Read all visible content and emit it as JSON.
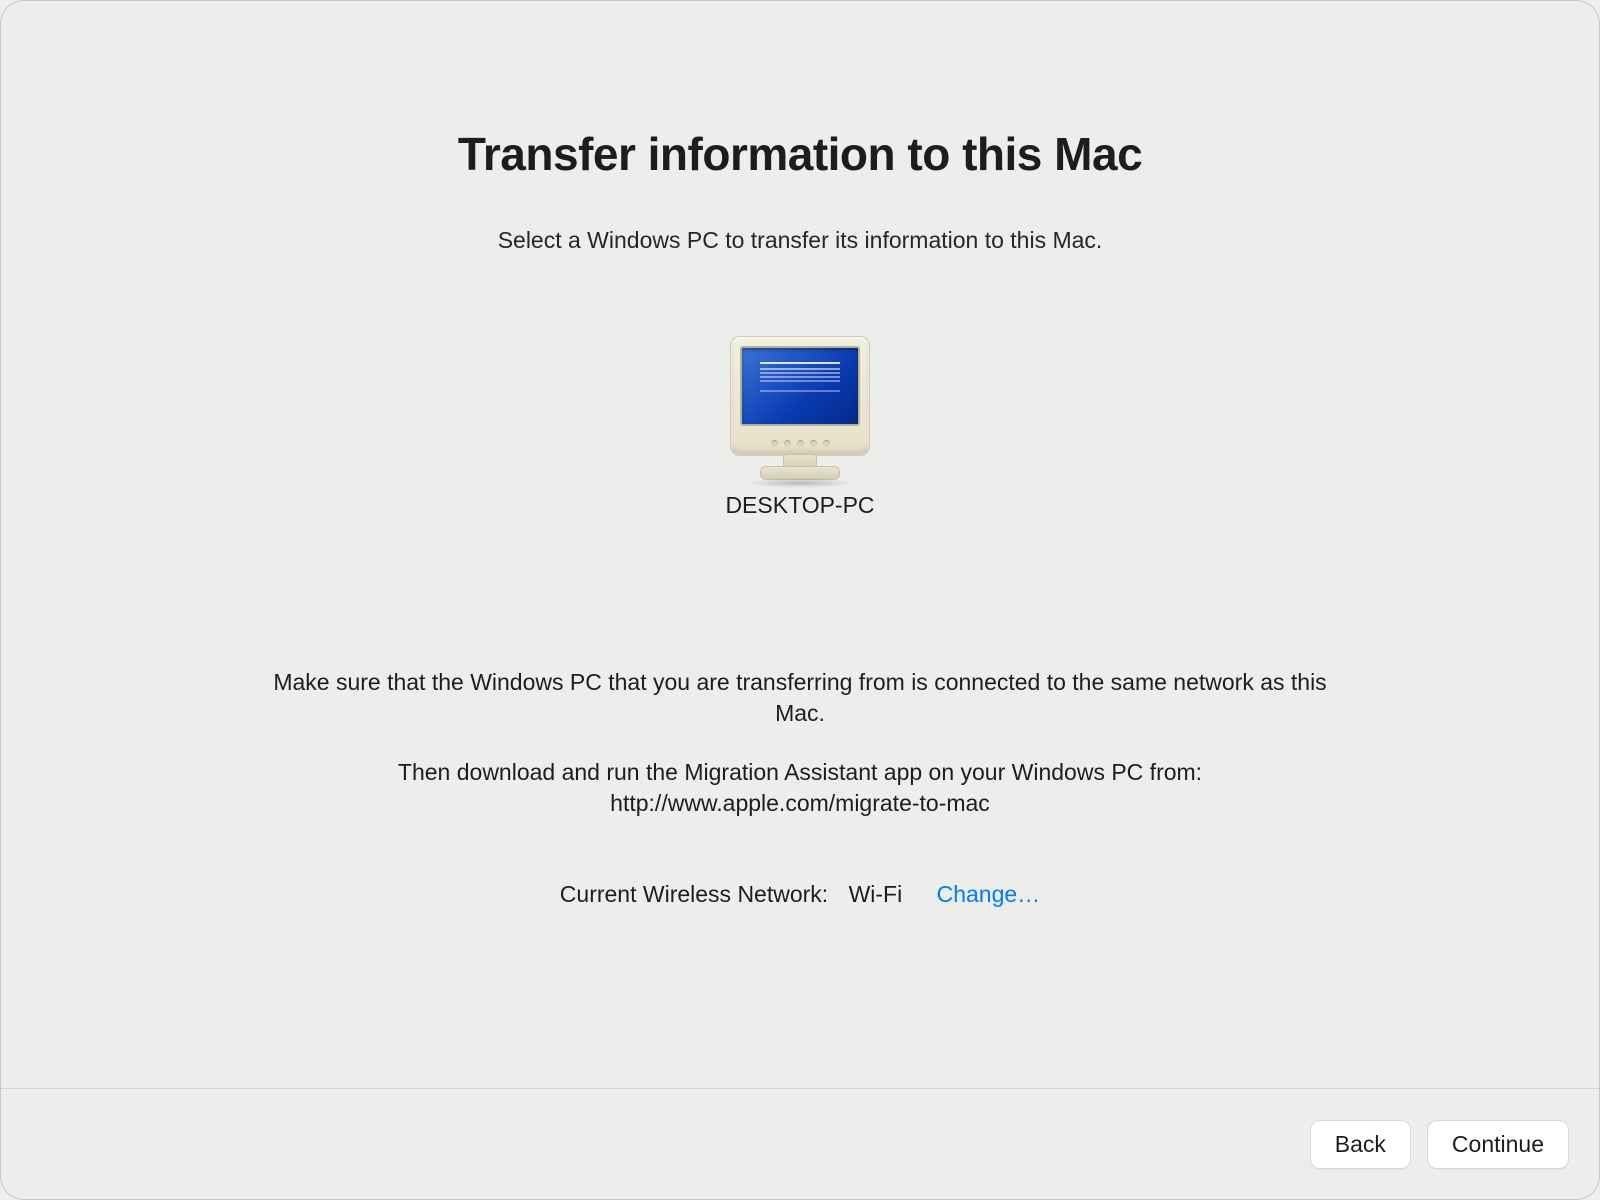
{
  "header": {
    "title": "Transfer information to this Mac",
    "subtitle": "Select a Windows PC to transfer its information to this Mac."
  },
  "device": {
    "name": "DESKTOP-PC",
    "icon": "pc-crt-icon"
  },
  "body": {
    "line1": "Make sure that the Windows PC that you are transferring from is connected to the same network as this Mac.",
    "line2": "Then download and run the Migration Assistant app on your Windows PC from:",
    "url": "http://www.apple.com/migrate-to-mac"
  },
  "network": {
    "label": "Current Wireless Network:",
    "value": "Wi-Fi",
    "change_label": "Change…"
  },
  "buttons": {
    "back": "Back",
    "continue": "Continue"
  }
}
